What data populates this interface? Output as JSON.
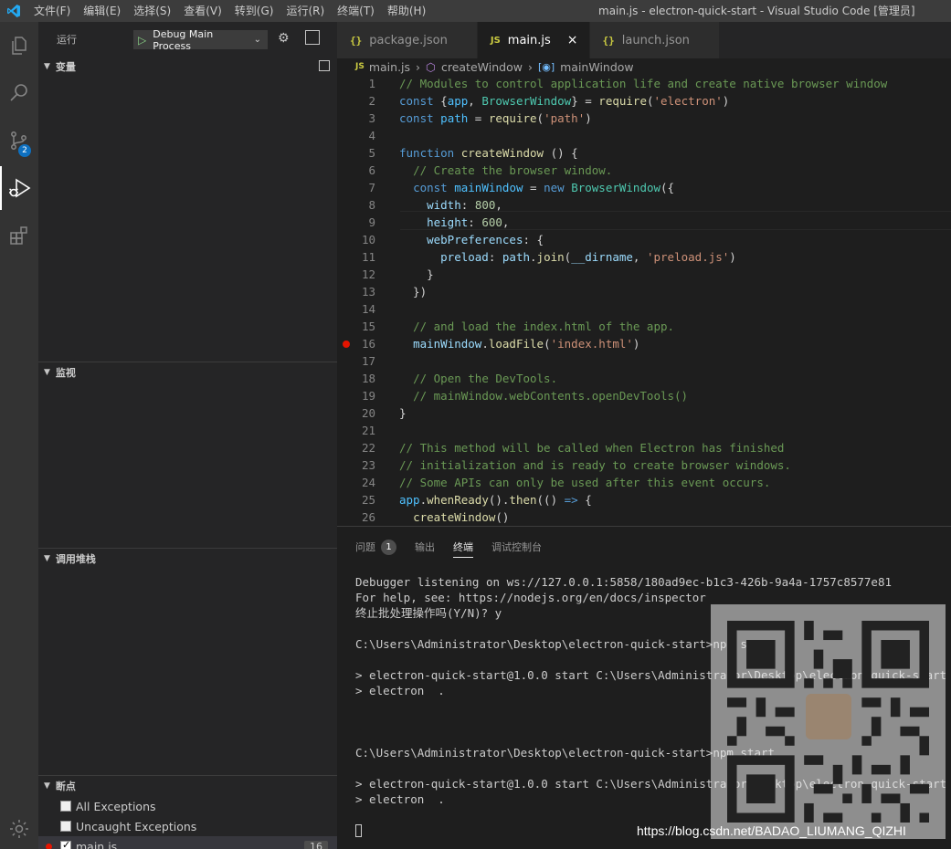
{
  "titlebar": {
    "menu": [
      "文件(F)",
      "编辑(E)",
      "选择(S)",
      "查看(V)",
      "转到(G)",
      "运行(R)",
      "终端(T)",
      "帮助(H)"
    ],
    "title": "main.js - electron-quick-start - Visual Studio Code [管理员]"
  },
  "activitybar": {
    "items": [
      "explorer-icon",
      "search-icon",
      "source-control-icon",
      "run-debug-icon",
      "extensions-icon"
    ],
    "scm_badge": "2",
    "bottom": "settings-gear-icon"
  },
  "sidebar": {
    "header": "运行",
    "launch_config": "Debug Main Process",
    "sections": {
      "variables": "变量",
      "watch": "监视",
      "callstack": "调用堆栈",
      "breakpoints": "断点"
    },
    "breakpoints": [
      {
        "label": "All Exceptions",
        "checked": false
      },
      {
        "label": "Uncaught Exceptions",
        "checked": false
      },
      {
        "label": "main.js",
        "checked": true,
        "count": "16"
      }
    ]
  },
  "tabs": [
    {
      "icon": "{}",
      "label": "package.json"
    },
    {
      "icon": "JS",
      "label": "main.js",
      "close": "×"
    },
    {
      "icon": "{}",
      "label": "launch.json"
    }
  ],
  "breadcrumb": {
    "file_icon": "JS",
    "file": "main.js",
    "fn": "createWindow",
    "var": "mainWindow"
  },
  "code": {
    "line_numbers": [
      "1",
      "2",
      "3",
      "4",
      "5",
      "6",
      "7",
      "8",
      "9",
      "10",
      "11",
      "12",
      "13",
      "14",
      "15",
      "16",
      "17",
      "18",
      "19",
      "20",
      "21",
      "22",
      "23",
      "24",
      "25",
      "26"
    ],
    "breakpoint_line": "16"
  },
  "panel": {
    "tabs": [
      {
        "label": "问题",
        "count": "1"
      },
      {
        "label": "输出"
      },
      {
        "label": "终端"
      },
      {
        "label": "调试控制台"
      }
    ],
    "terminal_lines": [
      "Debugger listening on ws://127.0.0.1:5858/180ad9ec-b1c3-426b-9a4a-1757c8577e81",
      "For help, see: https://nodejs.org/en/docs/inspector",
      "终止批处理操作吗(Y/N)? y",
      "",
      "C:\\Users\\Administrator\\Desktop\\electron-quick-start>npm start",
      "",
      "> electron-quick-start@1.0.0 start C:\\Users\\Administrator\\Desktop\\electron-quick-start",
      "> electron  .",
      "",
      "",
      "",
      "C:\\Users\\Administrator\\Desktop\\electron-quick-start>npm start",
      "",
      "> electron-quick-start@1.0.0 start C:\\Users\\Administrator\\Desktop\\electron-quick-start",
      "> electron  .",
      "",
      ""
    ]
  },
  "watermark": "https://blog.csdn.net/BADAO_LIUMANG_QIZHI",
  "colors": {
    "titlebar": "#3c3c3c",
    "activitybar": "#333333",
    "sidebar": "#252526",
    "editor": "#1e1e1e",
    "breakpoint": "#e51400",
    "badge": "#0e70c0"
  }
}
